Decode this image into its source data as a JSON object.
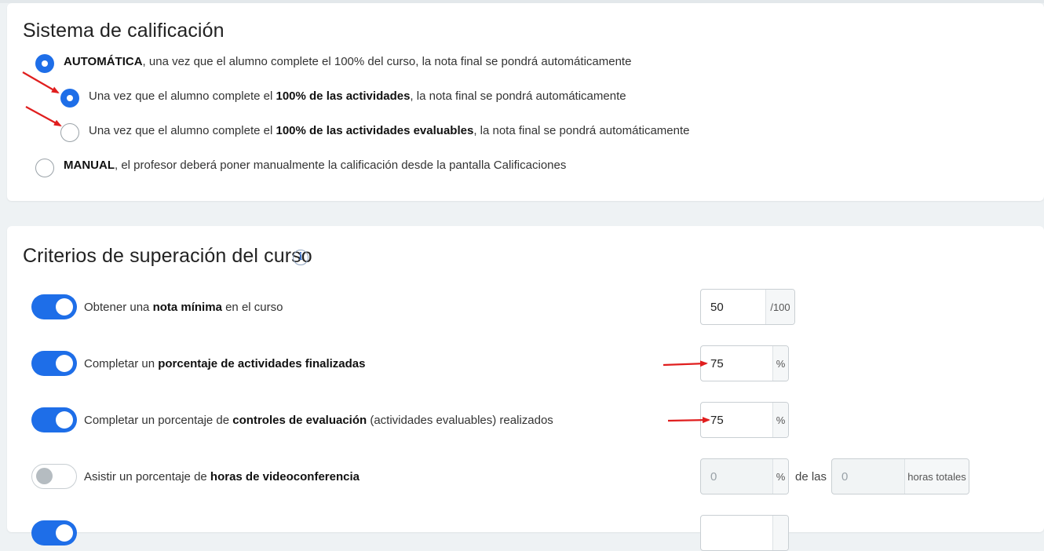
{
  "grading": {
    "title": "Sistema de calificación",
    "options": [
      {
        "bold": "AUTOMÁTICA",
        "text": ", una vez que el alumno complete el 100% del curso, la nota final se pondrá automáticamente",
        "selected": true
      },
      {
        "pre": "Una vez que el alumno complete el ",
        "bold": "100% de las actividades",
        "text": ", la nota final se pondrá automáticamente",
        "selected": true
      },
      {
        "pre": "Una vez que el alumno complete el ",
        "bold": "100% de las actividades evaluables",
        "text": ", la nota final se pondrá automáticamente",
        "selected": false
      },
      {
        "bold": "MANUAL",
        "text": ", el profesor deberá poner manualmente la calificación desde la pantalla Calificaciones",
        "selected": false
      }
    ]
  },
  "criteria": {
    "title": "Criterios de superación del curso",
    "info_icon": "i",
    "rows": [
      {
        "enabled": true,
        "pre": "Obtener una ",
        "bold": "nota mínima",
        "post": " en el curso",
        "value": "50",
        "unit": "/100"
      },
      {
        "enabled": true,
        "pre": "Completar un ",
        "bold": "porcentaje de actividades finalizadas",
        "post": "",
        "value": "75",
        "unit": "%"
      },
      {
        "enabled": true,
        "pre": "Completar un porcentaje de ",
        "bold": "controles de evaluación",
        "post": " (actividades evaluables) realizados",
        "value": "75",
        "unit": "%"
      },
      {
        "enabled": false,
        "pre": "Asistir un porcentaje de ",
        "bold": "horas de videoconferencia",
        "post": "",
        "value": "0",
        "unit": "%",
        "between": "de las",
        "value2": "0",
        "unit2": "horas totales"
      }
    ]
  },
  "colors": {
    "accent": "#1e6ee8",
    "annotation": "#e01e1e"
  }
}
